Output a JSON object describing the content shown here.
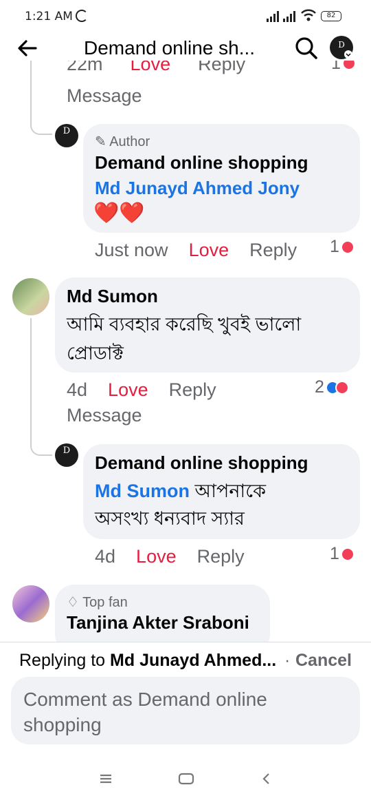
{
  "status_bar": {
    "time": "1:21 AM",
    "battery": "82"
  },
  "header": {
    "title": "Demand online sh...",
    "back_icon": "arrow-left",
    "search_icon": "magnifier"
  },
  "comments": {
    "prev_meta": {
      "time": "22m",
      "love": "Love",
      "reply": "Reply",
      "message": "Message",
      "count": "1"
    },
    "reply1": {
      "tag": "Author",
      "name": "Demand online shopping",
      "mention": "Md Junayd Ahmed Jony",
      "body_emoji": "❤️❤️",
      "time": "Just now",
      "love": "Love",
      "reply": "Reply",
      "count": "1"
    },
    "c2": {
      "name": "Md Sumon",
      "body_line1": "আমি ব্যবহার করেছি  খুবই ভালো",
      "body_line2": "প্রোডাক্ট",
      "time": "4d",
      "love": "Love",
      "reply": "Reply",
      "count": "2",
      "message": "Message"
    },
    "reply2": {
      "name": "Demand online shopping",
      "mention": "Md Sumon",
      "body_line1": "আপনাকে",
      "body_line2": "অসংখ্য ধন্যবাদ স্যার",
      "time": "4d",
      "love": "Love",
      "reply": "Reply",
      "count": "1"
    },
    "c3": {
      "tag": "Top fan",
      "name": "Tanjina Akter Sraboni"
    }
  },
  "reply_bar": {
    "prefix": "Replying to ",
    "target": "Md Junayd Ahmed...",
    "separator": " · ",
    "cancel": "Cancel",
    "placeholder": "Comment as Demand online shopping"
  },
  "colors": {
    "love": "#e41e3f",
    "mention": "#1b74e4",
    "bubble": "#f0f2f5",
    "meta": "#65676b"
  }
}
